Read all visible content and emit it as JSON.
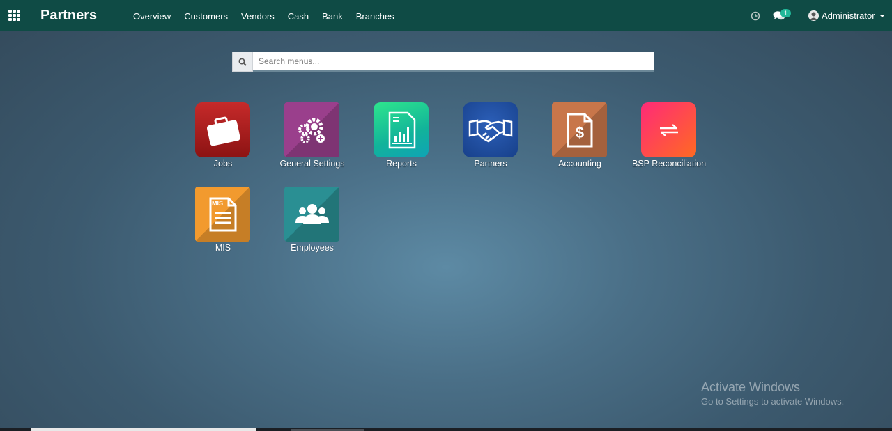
{
  "navbar": {
    "brand": "Partners",
    "menu": [
      "Overview",
      "Customers",
      "Vendors",
      "Cash",
      "Bank",
      "Branches"
    ],
    "chat_count": "1",
    "user": "Administrator"
  },
  "search": {
    "placeholder": "Search menus...",
    "value": ""
  },
  "apps": [
    {
      "label": "Jobs",
      "icon": "briefcase-icon",
      "color": "#a61e1e"
    },
    {
      "label": "General Settings",
      "icon": "gears-icon",
      "color": "#9a3f8c"
    },
    {
      "label": "Reports",
      "icon": "report-chart-icon",
      "color": "#1fd08a"
    },
    {
      "label": "Partners",
      "icon": "handshake-icon",
      "color": "#1f4fa3"
    },
    {
      "label": "Accounting",
      "icon": "invoice-dollar-icon",
      "color": "#c8764a"
    },
    {
      "label": "BSP Reconciliation",
      "icon": "exchange-arrows-icon",
      "color": "#fb3d6d"
    },
    {
      "label": "MIS",
      "icon": "mis-document-icon",
      "color": "#f29a2e"
    },
    {
      "label": "Employees",
      "icon": "users-icon",
      "color": "#2a8f93"
    }
  ],
  "watermark": {
    "title": "Activate Windows",
    "subtitle": "Go to Settings to activate Windows."
  }
}
